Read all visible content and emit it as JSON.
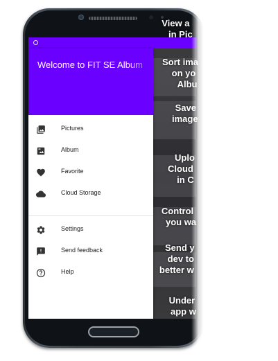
{
  "drawer": {
    "title": "Welcome to FIT SE Album",
    "items": [
      {
        "label": "Pictures",
        "icon": "photo-library-icon"
      },
      {
        "label": "Album",
        "icon": "image-icon"
      },
      {
        "label": "Favorite",
        "icon": "heart-icon"
      },
      {
        "label": "Cloud Storage",
        "icon": "cloud-icon"
      }
    ],
    "secondary_items": [
      {
        "label": "Settings",
        "icon": "gear-icon"
      },
      {
        "label": "Send feedback",
        "icon": "feedback-icon"
      },
      {
        "label": "Help",
        "icon": "help-icon"
      }
    ]
  },
  "onboarding": [
    {
      "line1": "View a",
      "line2": "in Pic"
    },
    {
      "line1": "Sort ima",
      "line2": "on yo",
      "line3": "Albu"
    },
    {
      "line1": "Save",
      "line2": "image"
    },
    {
      "line1": "Uplo",
      "line2": "Cloud",
      "line3": "in C"
    },
    {
      "line1": "Control",
      "line2": "you wa"
    },
    {
      "line1": "Send y",
      "line2": "dev to",
      "line3": "better w"
    },
    {
      "line1": "Under",
      "line2": "app w"
    }
  ],
  "colors": {
    "accent": "#6a00ff",
    "drawer_bg": "#ffffff",
    "text": "#202020"
  }
}
